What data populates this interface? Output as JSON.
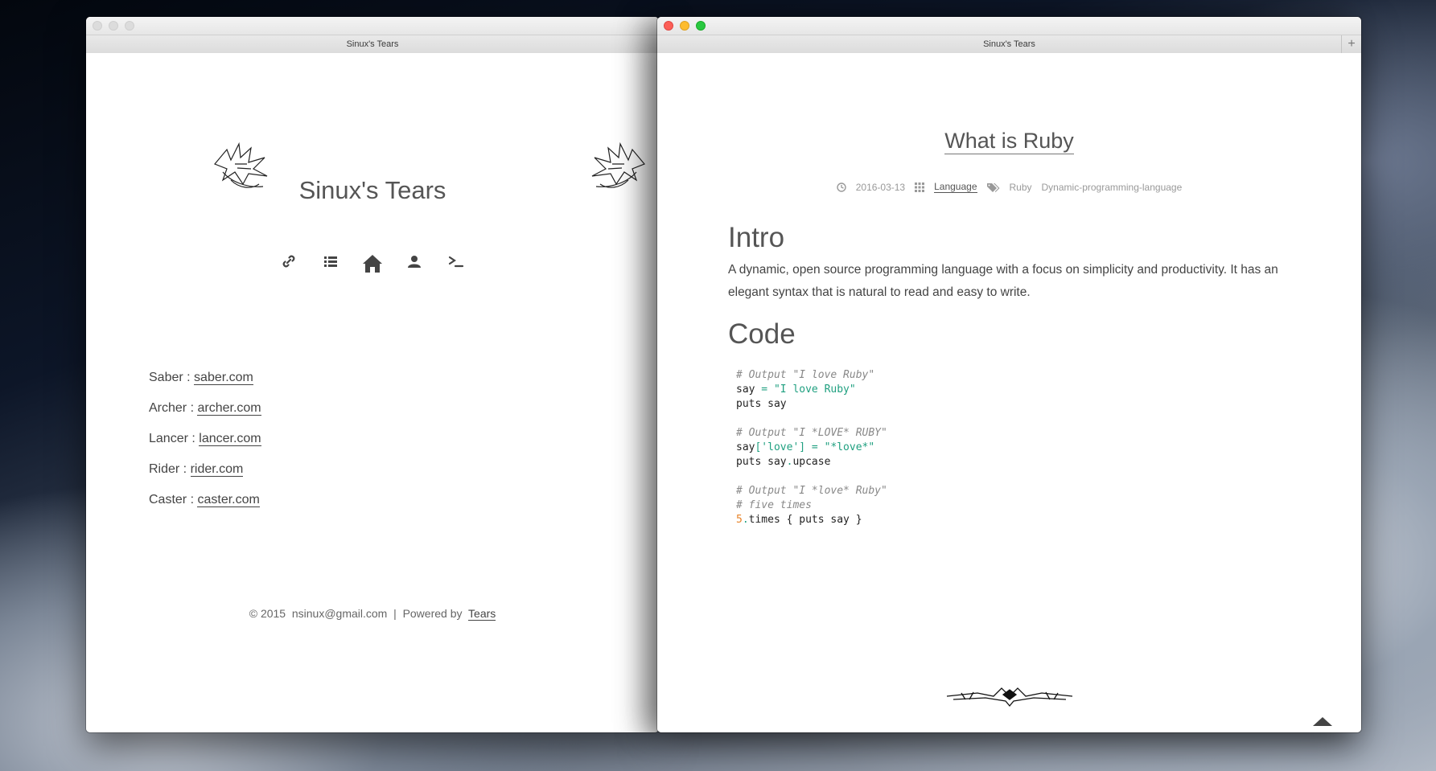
{
  "left_window": {
    "tab_title": "Sinux's Tears",
    "site_title": "Sinux's Tears",
    "nav": [
      {
        "icon": "link-icon"
      },
      {
        "icon": "list-icon"
      },
      {
        "icon": "home-icon"
      },
      {
        "icon": "user-icon"
      },
      {
        "icon": "terminal-icon"
      }
    ],
    "links": [
      {
        "label": "Saber :",
        "link": "saber.com"
      },
      {
        "label": "Archer :",
        "link": "archer.com"
      },
      {
        "label": "Lancer :",
        "link": "lancer.com"
      },
      {
        "label": "Rider :",
        "link": "rider.com"
      },
      {
        "label": "Caster :",
        "link": "caster.com"
      }
    ],
    "footer": {
      "copyright": "© 2015",
      "email": "nsinux@gmail.com",
      "separator": "|",
      "powered_by": "Powered by",
      "powered_link": "Tears"
    }
  },
  "right_window": {
    "tab_title": "Sinux's Tears",
    "new_tab_label": "+",
    "post_title": "What is Ruby",
    "meta": {
      "date": "2016-03-13",
      "category": "Language",
      "tags": [
        "Ruby",
        "Dynamic-programming-language"
      ]
    },
    "sections": {
      "intro_heading": "Intro",
      "intro_text": "A dynamic, open source programming language with a focus on simplicity and productivity. It has an elegant syntax that is natural to read and easy to write.",
      "code_heading": "Code"
    },
    "code": {
      "l1": "# Output \"I love Ruby\"",
      "l2a": "say",
      "l2b": " = ",
      "l2c": "\"I love Ruby\"",
      "l3": "puts say",
      "l4": "# Output \"I *LOVE* RUBY\"",
      "l5a": "say",
      "l5b": "['love'] = ",
      "l5c": "\"*love*\"",
      "l6a": "puts say",
      "l6b": ".",
      "l6c": "upcase",
      "l7": "# Output \"I *love* Ruby\"",
      "l8": "# five times",
      "l9a": "5",
      "l9b": ".",
      "l9c": "times { puts say }"
    }
  },
  "colors": {
    "accent_text": "#444444",
    "code_string": "#20a080",
    "code_number": "#e8842a",
    "close": "#fc5f57",
    "minimize": "#fdbc2e",
    "zoom": "#29c840"
  }
}
